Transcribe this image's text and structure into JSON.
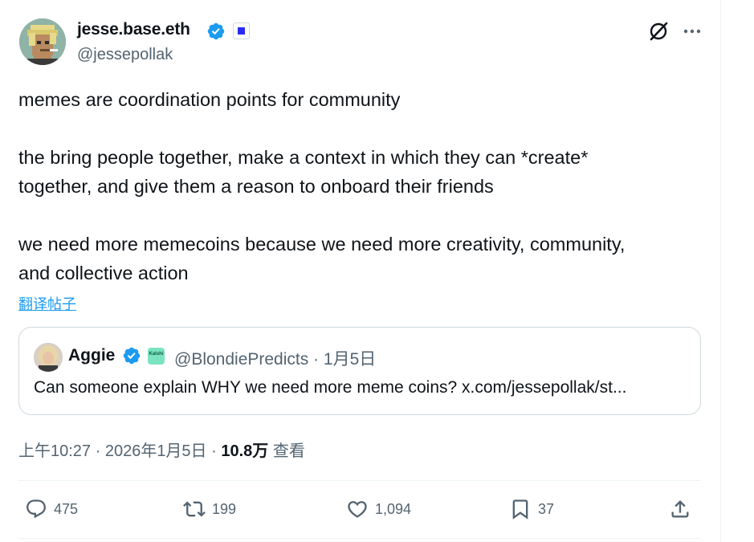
{
  "author": {
    "name": "jesse.base.eth",
    "handle": "@jessepollak"
  },
  "header_icons": [
    "grok-icon",
    "more-icon"
  ],
  "tweet": {
    "lines": [
      "memes are coordination points for community",
      "the bring people together, make a context in which they can *create*",
      "together, and give them a reason to onboard their friends",
      "we need more memecoins because we need more creativity, community,",
      "and collective action"
    ],
    "translate_label": "翻译帖子"
  },
  "quote": {
    "name": "Aggie",
    "badge_text": "Kalshi",
    "meta": "@BlondiePredicts · 1月5日",
    "text": "Can someone explain WHY we need more meme coins? x.com/jessepollak/st..."
  },
  "timestamp": {
    "time_date": "上午10:27 · 2026年1月5日 · ",
    "views": "10.8万",
    "views_label": " 查看"
  },
  "actions": {
    "replies": "475",
    "reposts": "199",
    "likes": "1,094",
    "bookmarks": "37"
  },
  "colors": {
    "accent": "#1d9bf0",
    "text": "#0f1419",
    "secondary": "#536471",
    "border": "#cfd9de"
  }
}
